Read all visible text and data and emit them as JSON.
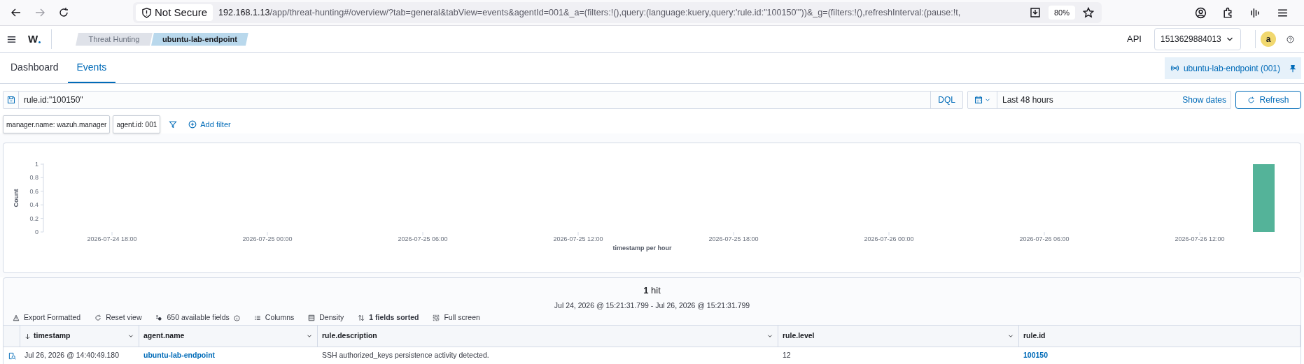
{
  "browser": {
    "security": "Not Secure",
    "url_host": "192.168.1.13",
    "url_path": "/app/threat-hunting#/overview/?tab=general&tabView=events&agentId=001&_a=(filters:!(),query:(language:kuery,query:'rule.id:\"100150\"'))&_g=(filters:!(),refreshInterval:(pause:!t,",
    "zoom": "80%"
  },
  "header": {
    "logo": "W",
    "breadcrumbs": [
      {
        "label": "Threat Hunting",
        "selected": false
      },
      {
        "label": "ubuntu-lab-endpoint",
        "selected": true
      }
    ],
    "api_label": "API",
    "api_value": "1513629884013",
    "avatar": "a"
  },
  "tabs": [
    {
      "label": "Dashboard",
      "selected": false
    },
    {
      "label": "Events",
      "selected": true
    }
  ],
  "pinned_agent": "ubuntu-lab-endpoint (001)",
  "query": {
    "value": "rule.id:\"100150\"",
    "language": "DQL"
  },
  "time": {
    "range": "Last 48 hours",
    "show_dates": "Show dates",
    "refresh": "Refresh"
  },
  "filters": [
    {
      "label": "manager.name: wazuh.manager"
    },
    {
      "label": "agent.id: 001"
    }
  ],
  "add_filter": "Add filter",
  "chart": {
    "chart_data": {
      "type": "bar",
      "xlabel": "timestamp per hour",
      "ylabel": "Count",
      "categories": [
        null,
        null,
        null,
        "2026-07-24 18:00",
        null,
        null,
        null,
        null,
        null,
        "2026-07-25 00:00",
        null,
        null,
        null,
        null,
        null,
        "2026-07-25 06:00",
        null,
        null,
        null,
        null,
        null,
        "2026-07-25 12:00",
        null,
        null,
        null,
        null,
        null,
        "2026-07-25 18:00",
        null,
        null,
        null,
        null,
        null,
        "2026-07-26 00:00",
        null,
        null,
        null,
        null,
        null,
        "2026-07-26 06:00",
        null,
        null,
        null,
        null,
        null,
        "2026-07-26 12:00",
        null,
        null
      ],
      "series": [
        {
          "color": "#54b399",
          "values": [
            null,
            null,
            null,
            null,
            null,
            null,
            null,
            null,
            null,
            null,
            null,
            null,
            null,
            null,
            null,
            null,
            null,
            null,
            null,
            null,
            null,
            null,
            null,
            null,
            null,
            null,
            null,
            null,
            null,
            null,
            null,
            null,
            null,
            null,
            null,
            null,
            null,
            null,
            null,
            null,
            null,
            null,
            null,
            null,
            null,
            null,
            null,
            1
          ]
        }
      ],
      "ylim": [
        0,
        1
      ],
      "yticks": [
        0,
        0.2,
        0.4,
        0.6,
        0.8,
        1
      ]
    }
  },
  "results": {
    "count": "1",
    "count_label": "hit",
    "range": "Jul 24, 2026 @ 15:21:31.799 - Jul 26, 2026 @ 15:21:31.799",
    "toolbar": [
      {
        "label": "Export Formatted",
        "kind": "export",
        "active": false
      },
      {
        "label": "Reset view",
        "kind": "reset",
        "active": false
      },
      {
        "label": "650 available fields",
        "kind": "fields",
        "active": false
      },
      {
        "label": "Columns",
        "kind": "columns",
        "active": false
      },
      {
        "label": "Density",
        "kind": "density",
        "active": false
      },
      {
        "label": "1 fields sorted",
        "kind": "sort",
        "active": true
      },
      {
        "label": "Full screen",
        "kind": "fullscreen",
        "active": false
      }
    ]
  },
  "table": {
    "columns": [
      {
        "label": "timestamp",
        "sorted": true,
        "menu": true
      },
      {
        "label": "agent.name",
        "sorted": false,
        "menu": true
      },
      {
        "label": "rule.description",
        "sorted": false,
        "menu": true
      },
      {
        "label": "rule.level",
        "sorted": false,
        "menu": true
      },
      {
        "label": "rule.id",
        "sorted": false,
        "menu": false
      }
    ],
    "rows": [
      {
        "cells": [
          {
            "text": "Jul 26, 2026 @ 14:40:49.180",
            "link": false
          },
          {
            "text": "ubuntu-lab-endpoint",
            "link": true
          },
          {
            "text": "SSH authorized_keys persistence activity detected.",
            "link": false
          },
          {
            "text": "12",
            "link": false
          },
          {
            "text": "100150",
            "link": true
          }
        ]
      }
    ]
  }
}
